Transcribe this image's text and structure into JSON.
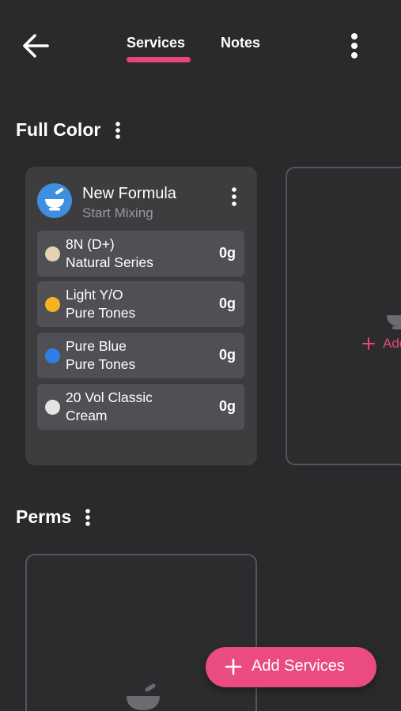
{
  "header": {
    "tabs": [
      {
        "label": "Services",
        "active": true
      },
      {
        "label": "Notes",
        "active": false
      }
    ],
    "back_icon": "arrow-left-icon",
    "more_icon": "vertical-dots-icon"
  },
  "sections": [
    {
      "title": "Full Color",
      "formula": {
        "title": "New Formula",
        "subtitle": "Start Mixing",
        "icon": "mortar-pestle-icon",
        "items": [
          {
            "name": "8N (D+)",
            "line": "Natural Series",
            "amount": "0g",
            "color": "#e3d3b0"
          },
          {
            "name": "Light Y/O",
            "line": "Pure Tones",
            "amount": "0g",
            "color": "#f5b324"
          },
          {
            "name": "Pure Blue",
            "line": "Pure Tones",
            "amount": "0g",
            "color": "#2f7fe6"
          },
          {
            "name": "20 Vol Classic",
            "line": "Cream",
            "amount": "0g",
            "color": "#e4e4e4"
          }
        ]
      },
      "add_label": "Add"
    },
    {
      "title": "Perms"
    }
  ],
  "fab": {
    "label": "Add Services"
  },
  "colors": {
    "accent": "#ea4c7f",
    "background": "#2a2a2c",
    "card": "#3d3d40",
    "row": "#505054"
  }
}
